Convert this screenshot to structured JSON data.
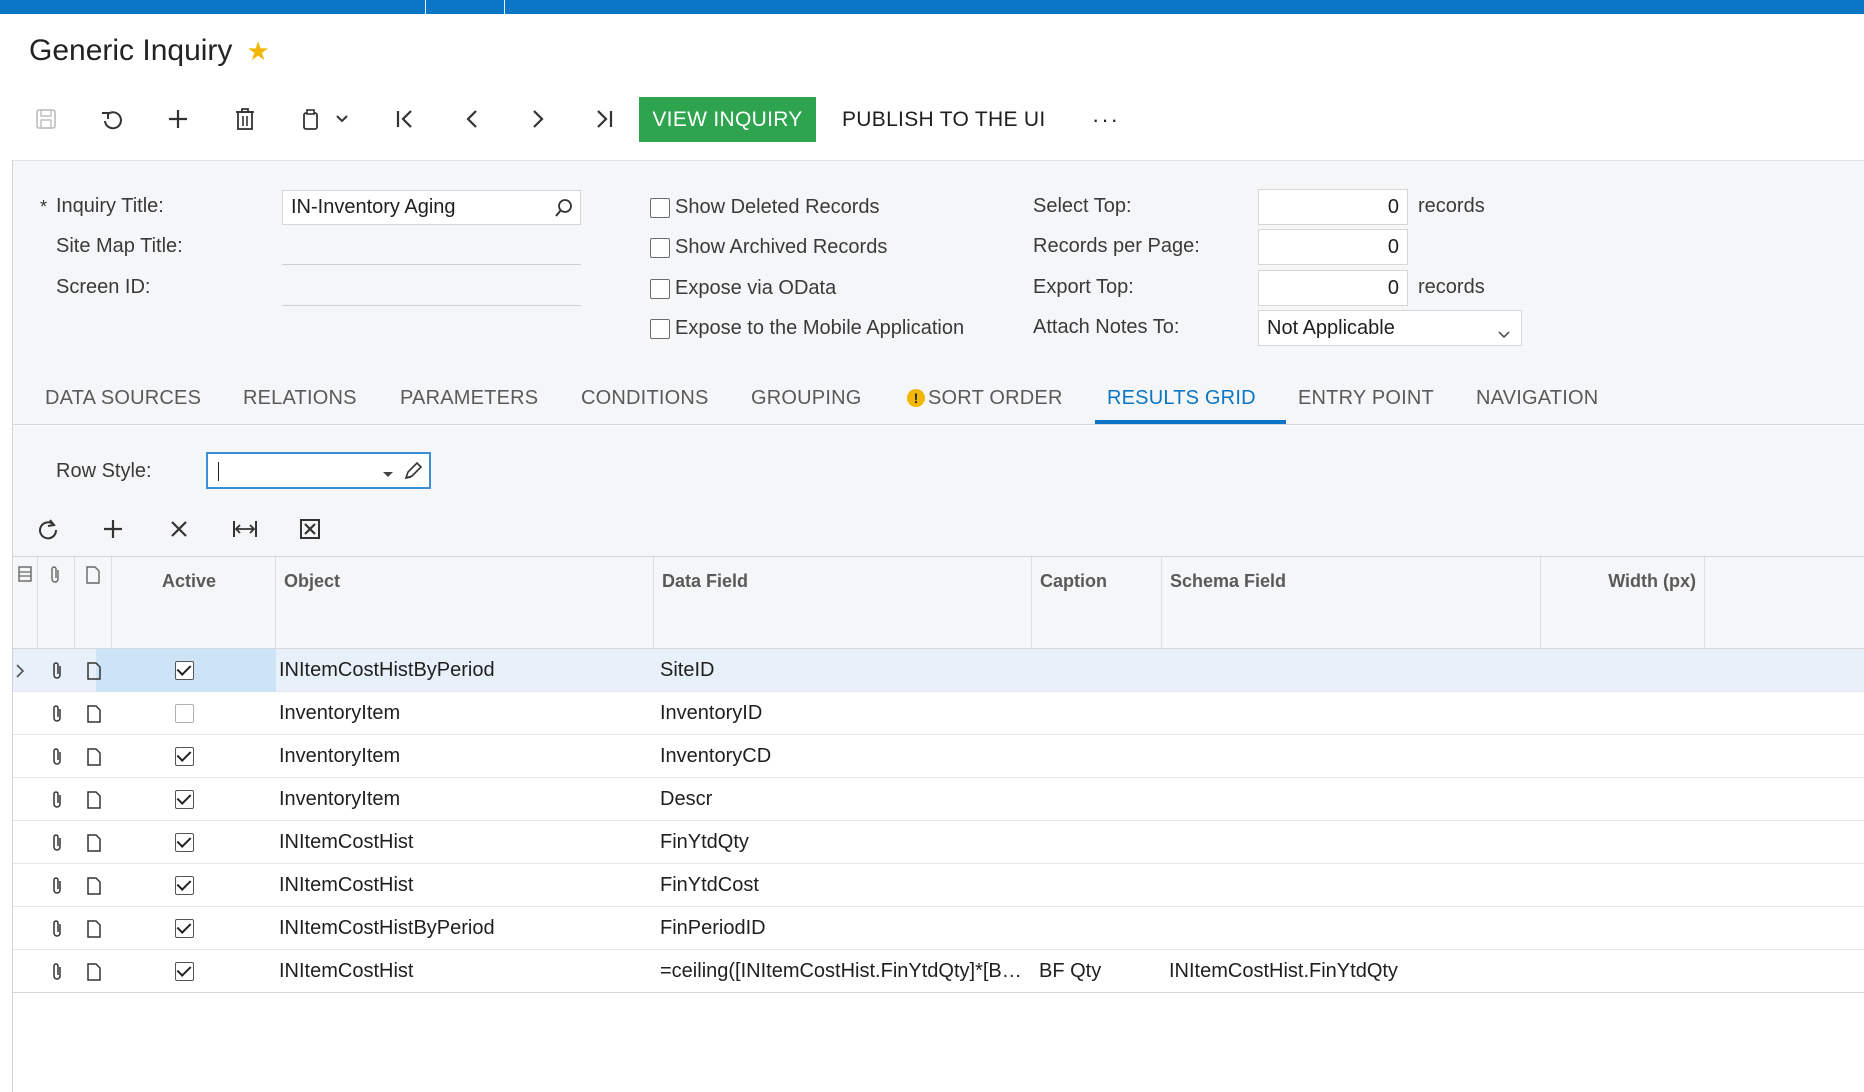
{
  "app": {
    "title": "Generic Inquiry",
    "accent_color": "#0b76c5",
    "primary_button_color": "#2ea44f"
  },
  "toolbar": {
    "icons": [
      "save-icon",
      "undo-icon",
      "add-icon",
      "delete-icon",
      "copy-paste-icon",
      "chevron-down-icon",
      "first-record-icon",
      "previous-record-icon",
      "next-record-icon",
      "last-record-icon"
    ],
    "view_inquiry_label": "VIEW INQUIRY",
    "publish_label": "PUBLISH TO THE UI",
    "more_label": "···"
  },
  "form": {
    "required_mark": "*",
    "inquiry_title_label": "Inquiry Title:",
    "inquiry_title_value": "IN-Inventory Aging",
    "site_map_title_label": "Site Map Title:",
    "site_map_title_value": "",
    "screen_id_label": "Screen ID:",
    "screen_id_value": "",
    "show_deleted_label": "Show Deleted Records",
    "show_archived_label": "Show Archived Records",
    "expose_odata_label": "Expose via OData",
    "expose_mobile_label": "Expose to the Mobile Application",
    "select_top_label": "Select Top:",
    "select_top_value": "0",
    "select_top_unit": "records",
    "records_per_page_label": "Records per Page:",
    "records_per_page_value": "0",
    "export_top_label": "Export Top:",
    "export_top_value": "0",
    "export_top_unit": "records",
    "attach_notes_label": "Attach Notes To:",
    "attach_notes_value": "Not Applicable"
  },
  "tabs": [
    {
      "label": "DATA SOURCES"
    },
    {
      "label": "RELATIONS"
    },
    {
      "label": "PARAMETERS"
    },
    {
      "label": "CONDITIONS"
    },
    {
      "label": "GROUPING"
    },
    {
      "label": "SORT ORDER",
      "warning": "!"
    },
    {
      "label": "RESULTS GRID",
      "active": true
    },
    {
      "label": "ENTRY POINT"
    },
    {
      "label": "NAVIGATION"
    }
  ],
  "results_grid": {
    "row_style_label": "Row Style:",
    "row_style_value": "",
    "grid_icons": [
      "refresh-icon",
      "add-row-icon",
      "delete-row-icon",
      "fit-columns-icon",
      "export-excel-icon"
    ],
    "columns": {
      "active": "Active",
      "object": "Object",
      "data_field": "Data Field",
      "caption": "Caption",
      "schema_field": "Schema Field",
      "width": "Width (px)"
    },
    "rows": [
      {
        "active": true,
        "object": "INItemCostHistByPeriod",
        "data_field": "SiteID",
        "caption": "",
        "schema_field": "",
        "selected": true
      },
      {
        "active": false,
        "object": "InventoryItem",
        "data_field": "InventoryID",
        "caption": "",
        "schema_field": ""
      },
      {
        "active": true,
        "object": "InventoryItem",
        "data_field": "InventoryCD",
        "caption": "",
        "schema_field": ""
      },
      {
        "active": true,
        "object": "InventoryItem",
        "data_field": "Descr",
        "caption": "",
        "schema_field": ""
      },
      {
        "active": true,
        "object": "INItemCostHist",
        "data_field": "FinYtdQty",
        "caption": "",
        "schema_field": ""
      },
      {
        "active": true,
        "object": "INItemCostHist",
        "data_field": "FinYtdCost",
        "caption": "",
        "schema_field": ""
      },
      {
        "active": true,
        "object": "INItemCostHistByPeriod",
        "data_field": "FinPeriodID",
        "caption": "",
        "schema_field": ""
      },
      {
        "active": true,
        "object": "INItemCostHist",
        "data_field": "=ceiling([INItemCostHist.FinYtdQty]*[B…",
        "caption": "BF Qty",
        "schema_field": "INItemCostHist.FinYtdQty"
      }
    ]
  }
}
